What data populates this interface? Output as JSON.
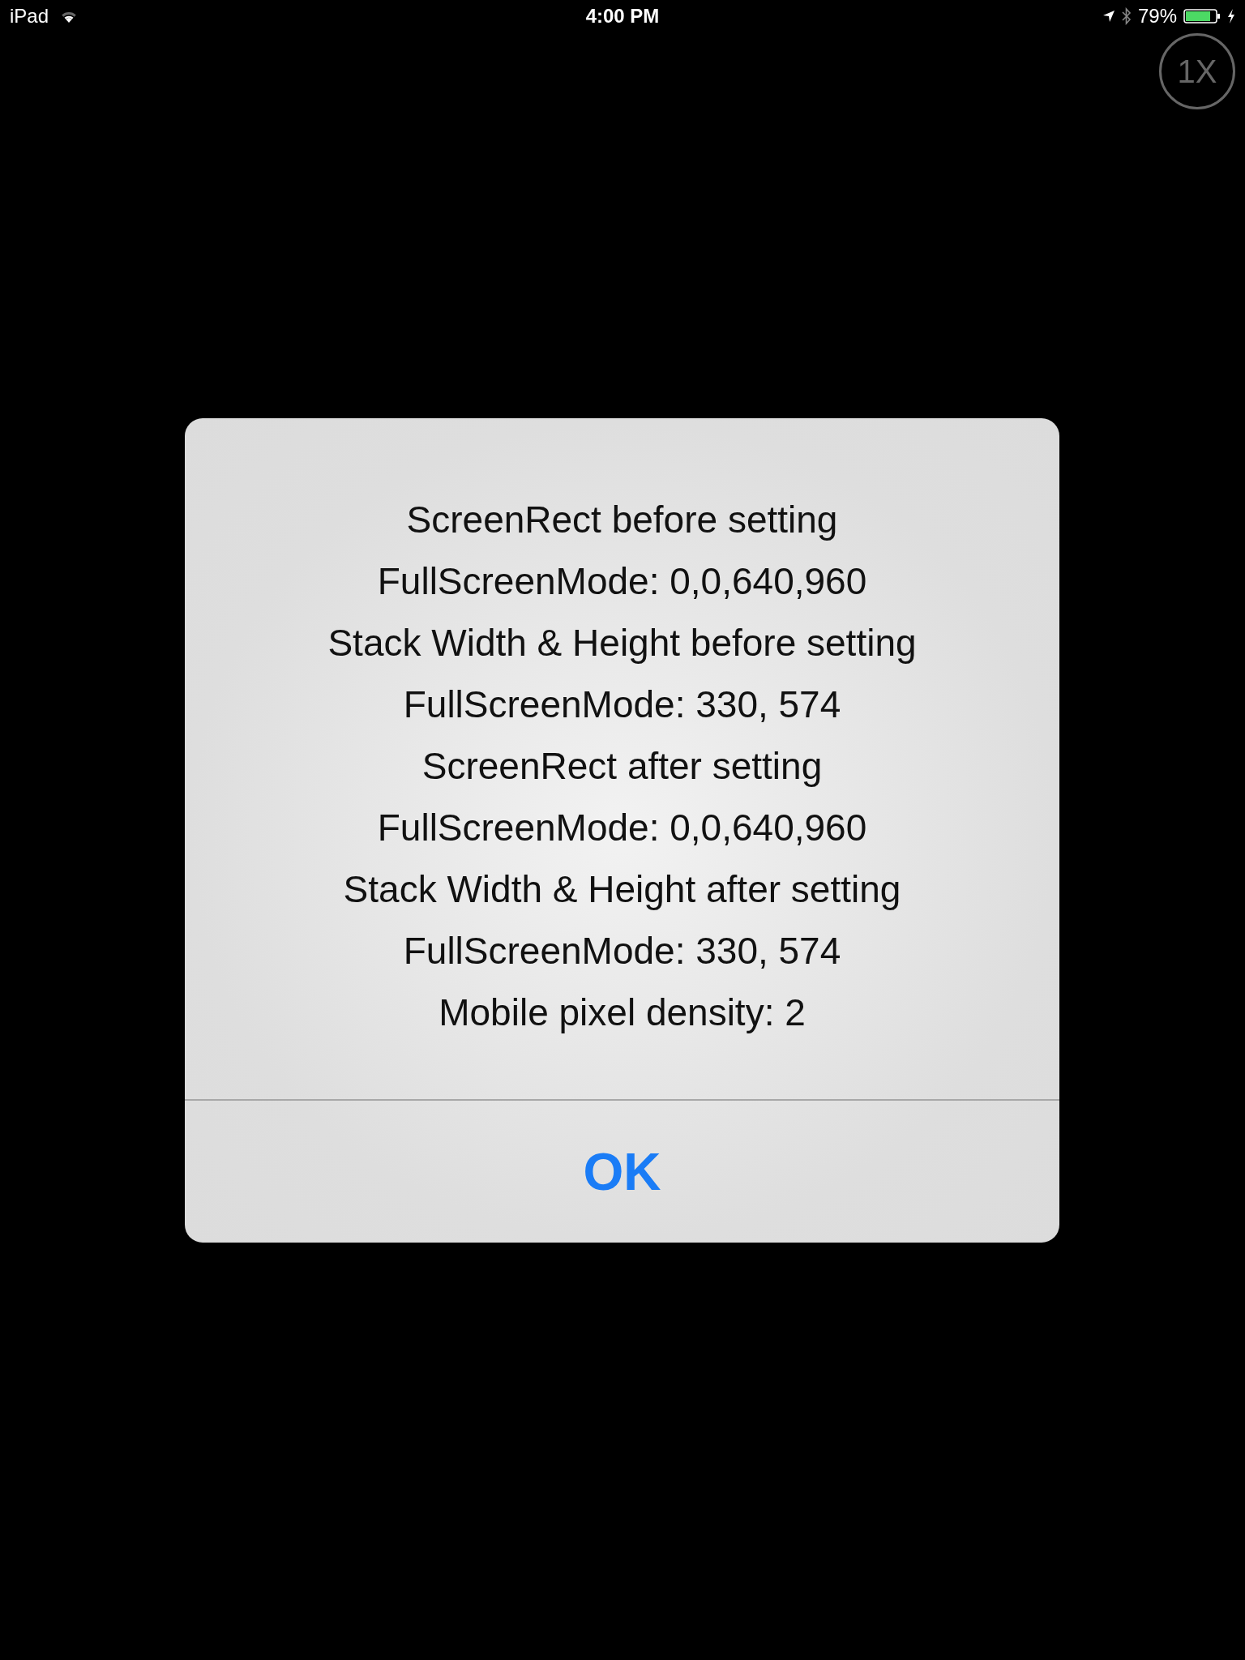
{
  "status_bar": {
    "device": "iPad",
    "time": "4:00 PM",
    "battery": "79%"
  },
  "zoom_button": {
    "label": "1X"
  },
  "alert": {
    "lines": [
      "ScreenRect before setting",
      "FullScreenMode: 0,0,640,960",
      "Stack Width & Height before setting",
      "FullScreenMode: 330, 574",
      "ScreenRect after setting",
      "FullScreenMode: 0,0,640,960",
      "Stack Width & Height after setting",
      "FullScreenMode: 330, 574",
      "Mobile pixel density: 2"
    ],
    "buttons": [
      "OK"
    ]
  }
}
